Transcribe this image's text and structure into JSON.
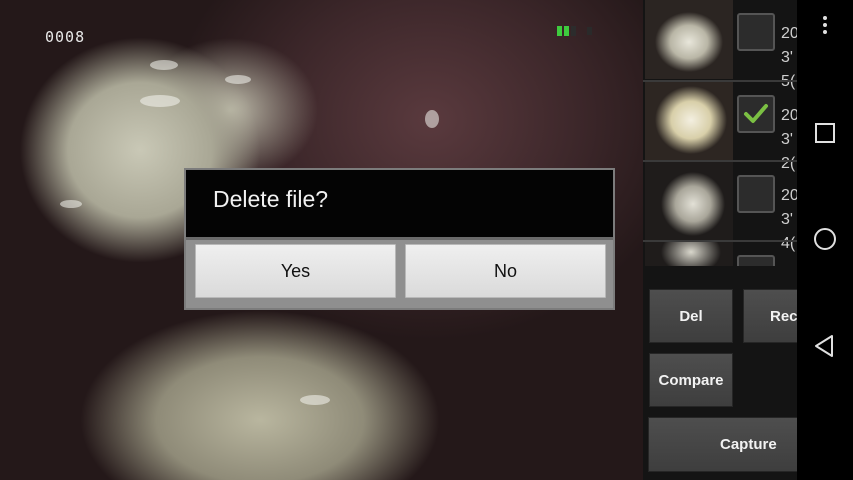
{
  "preview": {
    "frame_counter": "0008"
  },
  "thumbnails": [
    {
      "checked": false,
      "text": "20\n3'\n5("
    },
    {
      "checked": true,
      "text": "20\n3'\n2("
    },
    {
      "checked": false,
      "text": "20\n3'\n4("
    },
    {
      "checked": false,
      "text": ""
    }
  ],
  "thumb_texts": [
    "20",
    "3'",
    "5(",
    "20",
    "3'",
    "2(",
    "20",
    "3'",
    "4("
  ],
  "buttons": {
    "del": "Del",
    "rec": "Rec",
    "compare": "Compare",
    "capture": "Capture"
  },
  "dialog": {
    "title": "Delete file?",
    "yes": "Yes",
    "no": "No"
  },
  "colors": {
    "check_accent": "#7bc043",
    "battery": "#3ecb3e"
  }
}
